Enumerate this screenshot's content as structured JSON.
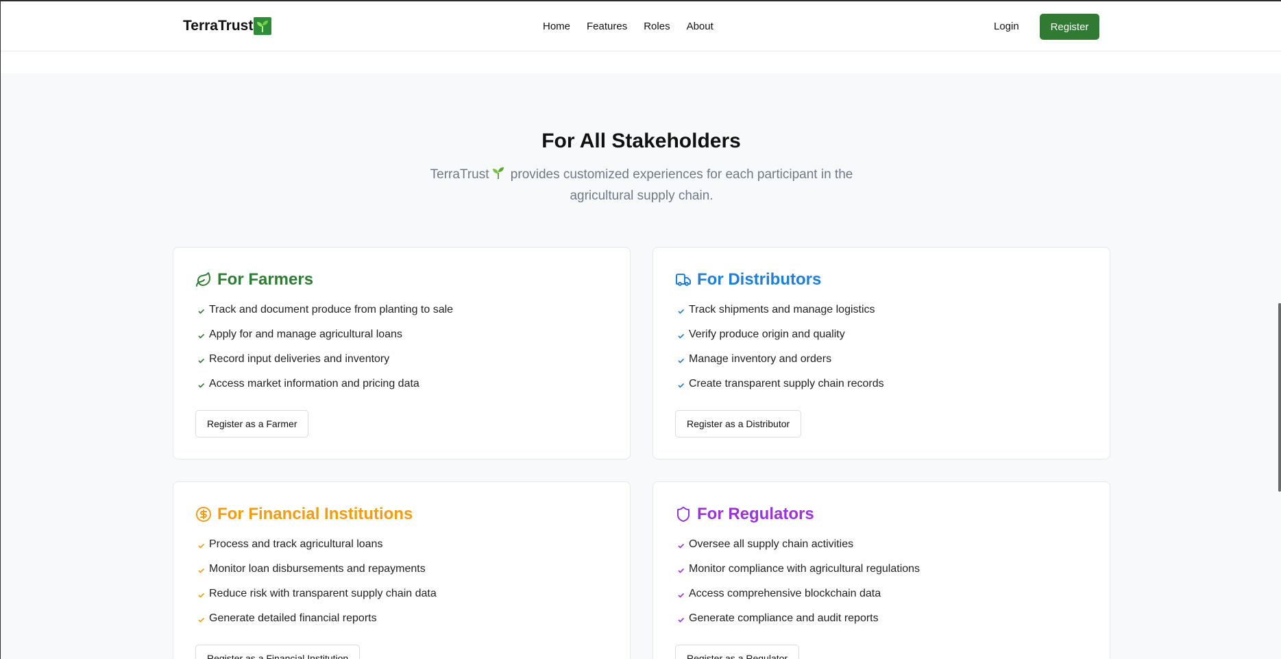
{
  "header": {
    "logo": "TerraTrust",
    "nav": [
      "Home",
      "Features",
      "Roles",
      "About"
    ],
    "login": "Login",
    "register": "Register"
  },
  "section": {
    "title": "For All Stakeholders",
    "subtitle_pre": "TerraTrust",
    "subtitle_post": " provides customized experiences for each participant in the agricultural supply chain."
  },
  "cards": [
    {
      "title": "For Farmers",
      "icon": "leaf-icon",
      "color": "#2e7d32",
      "features": [
        "Track and document produce from planting to sale",
        "Apply for and manage agricultural loans",
        "Record input deliveries and inventory",
        "Access market information and pricing data"
      ],
      "button": "Register as a Farmer"
    },
    {
      "title": "For Distributors",
      "icon": "truck-icon",
      "color": "#1f7ed6",
      "features": [
        "Track shipments and manage logistics",
        "Verify produce origin and quality",
        "Manage inventory and orders",
        "Create transparent supply chain records"
      ],
      "button": "Register as a Distributor"
    },
    {
      "title": "For Financial Institutions",
      "icon": "dollar-circle-icon",
      "color": "#f29c12",
      "features": [
        "Process and track agricultural loans",
        "Monitor loan disbursements and repayments",
        "Reduce risk with transparent supply chain data",
        "Generate detailed financial reports"
      ],
      "button": "Register as a Financial Institution"
    },
    {
      "title": "For Regulators",
      "icon": "shield-icon",
      "color": "#9b34d8",
      "features": [
        "Oversee all supply chain activities",
        "Monitor compliance with agricultural regulations",
        "Access comprehensive blockchain data",
        "Generate compliance and audit reports"
      ],
      "button": "Register as a Regulator"
    }
  ]
}
